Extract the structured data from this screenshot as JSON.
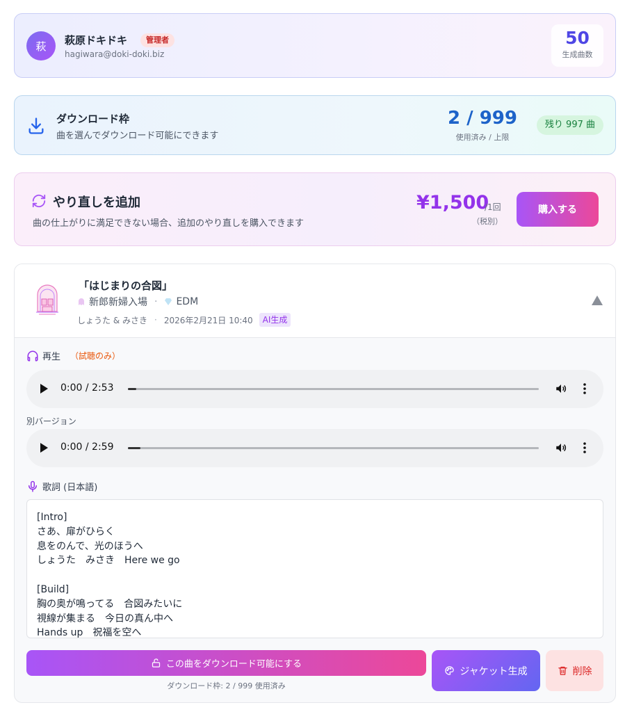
{
  "profile": {
    "avatar_initial": "萩",
    "name": "萩原ドキドキ",
    "role_badge": "管理者",
    "email": "hagiwara@doki-doki.biz",
    "songs_count": "50",
    "songs_count_label": "生成曲数"
  },
  "download_quota": {
    "title": "ダウンロード枠",
    "subtitle": "曲を選んでダウンロード可能にできます",
    "count": "2 / 999",
    "count_label": "使用済み / 上限",
    "remaining": "残り 997 曲"
  },
  "redo": {
    "title": "やり直しを追加",
    "subtitle": "曲の仕上がりに満足できない場合、追加のやり直しを購入できます",
    "price": "¥1,500",
    "price_unit": "/1回",
    "price_tax": "（税別）",
    "buy_button": "購入する"
  },
  "song": {
    "title": "「はじまりの合図」",
    "scene": "新郎新婦入場",
    "genre": "EDM",
    "meta_separator": "·",
    "couple": "しょうた & みさき",
    "date": "2026年2月21日 10:40",
    "ai_badge": "AI生成",
    "playback_label": "再生",
    "playback_note": "（試聴のみ）",
    "player1": {
      "time": "0:00 / 2:53",
      "progress": 0.02
    },
    "alt_version_label": "別バージョン",
    "player2": {
      "time": "0:00 / 2:59",
      "progress": 0.03
    },
    "lyrics_label": "歌詞 (日本語)",
    "lyrics": [
      "[Intro]",
      "さあ、扉がひらく",
      "息をのんで、光のほうへ",
      "しょうた　みさき　Here we go",
      "",
      "[Build]",
      "胸の奥が鳴ってる　合図みたいに",
      "視線が集まる　今日の真ん中へ",
      "Hands up　祝福を空へ"
    ],
    "enable_download_button": "この曲をダウンロード可能にする",
    "download_note": "ダウンロード枠: 2 / 999 使用済み",
    "jacket_button": "ジャケット生成",
    "delete_button": "削除"
  },
  "colors": {
    "accent_purple": "#a855f7",
    "accent_pink": "#ec4899",
    "quota_blue": "#1d63c9",
    "remaining_green": "#17803d",
    "delete_red": "#dc2626"
  }
}
